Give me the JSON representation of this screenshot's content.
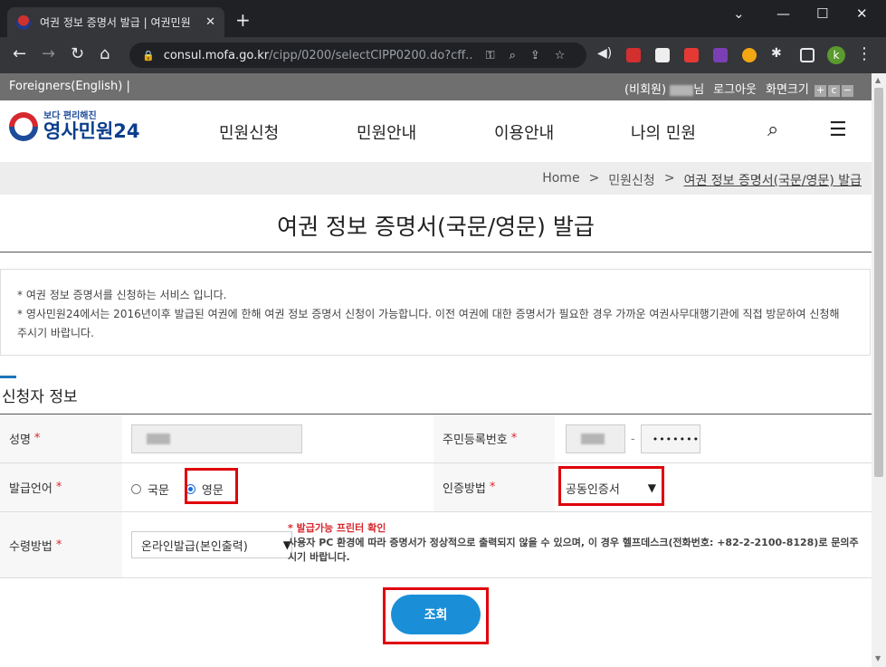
{
  "browser": {
    "tab_title": "여권 정보 증명서 발급 | 여권민원",
    "url_host": "consul.mofa.go.kr",
    "url_path": "/cipp/0200/selectCIPP0200.do?cff...",
    "profile_initial": "k",
    "colors": {
      "tabbar": "#202124",
      "toolbar": "#35363a"
    }
  },
  "utilbar": {
    "lang": "Foreigners(English) |",
    "guest_label": "(비회원)",
    "name_suffix": "님",
    "logout": "로그아웃",
    "zoom_label": "화면크기",
    "zoom_in": "+",
    "zoom_reset": "c",
    "zoom_out": "−"
  },
  "header": {
    "logo_small": "보다 편리해진",
    "logo_big": "영사민원24",
    "nav": [
      "민원신청",
      "민원안내",
      "이용안내",
      "나의 민원"
    ]
  },
  "breadcrumb": {
    "home": "Home",
    "sep": ">",
    "level1": "민원신청",
    "current": "여권 정보 증명서(국문/영문) 발급"
  },
  "page_title": "여권 정보 증명서(국문/영문) 발급",
  "notice": {
    "line1": "* 여권 정보 증명서를 신청하는 서비스 입니다.",
    "line2": "* 영사민원24에서는 2016년이후 발급된 여권에 한해 여권 정보 증명서 신청이 가능합니다. 이전 여권에 대한 증명서가 필요한 경우 가까운 여권사무대행기관에 직접 방문하여 신청해",
    "line3": "주시기 바랍니다."
  },
  "section_title": "신청자 정보",
  "form": {
    "name_label": "성명",
    "ssn_label": "주민등록번호",
    "ssn_dash": "-",
    "ssn_masked": "•••••••",
    "lang_label": "발급언어",
    "lang_options": [
      "국문",
      "영문"
    ],
    "lang_selected": "영문",
    "auth_label": "인증방법",
    "auth_value": "공동인증서",
    "receive_label": "수령방법",
    "receive_value": "온라인발급(본인출력)",
    "required_mark": "*",
    "warn_title": "* 발급가능 프린터 확인",
    "warn_body": "사용자 PC 환경에 따라 증명서가 정상적으로 출력되지 않을 수 있으며, 이 경우 헬프데스크(전화번호: +82-2-2100-8128)로 문의주시기 바랍니다."
  },
  "submit_label": "조회",
  "colors": {
    "accent": "#1a8fd8",
    "highlight_box": "#e0000a",
    "required": "#d7282f"
  }
}
